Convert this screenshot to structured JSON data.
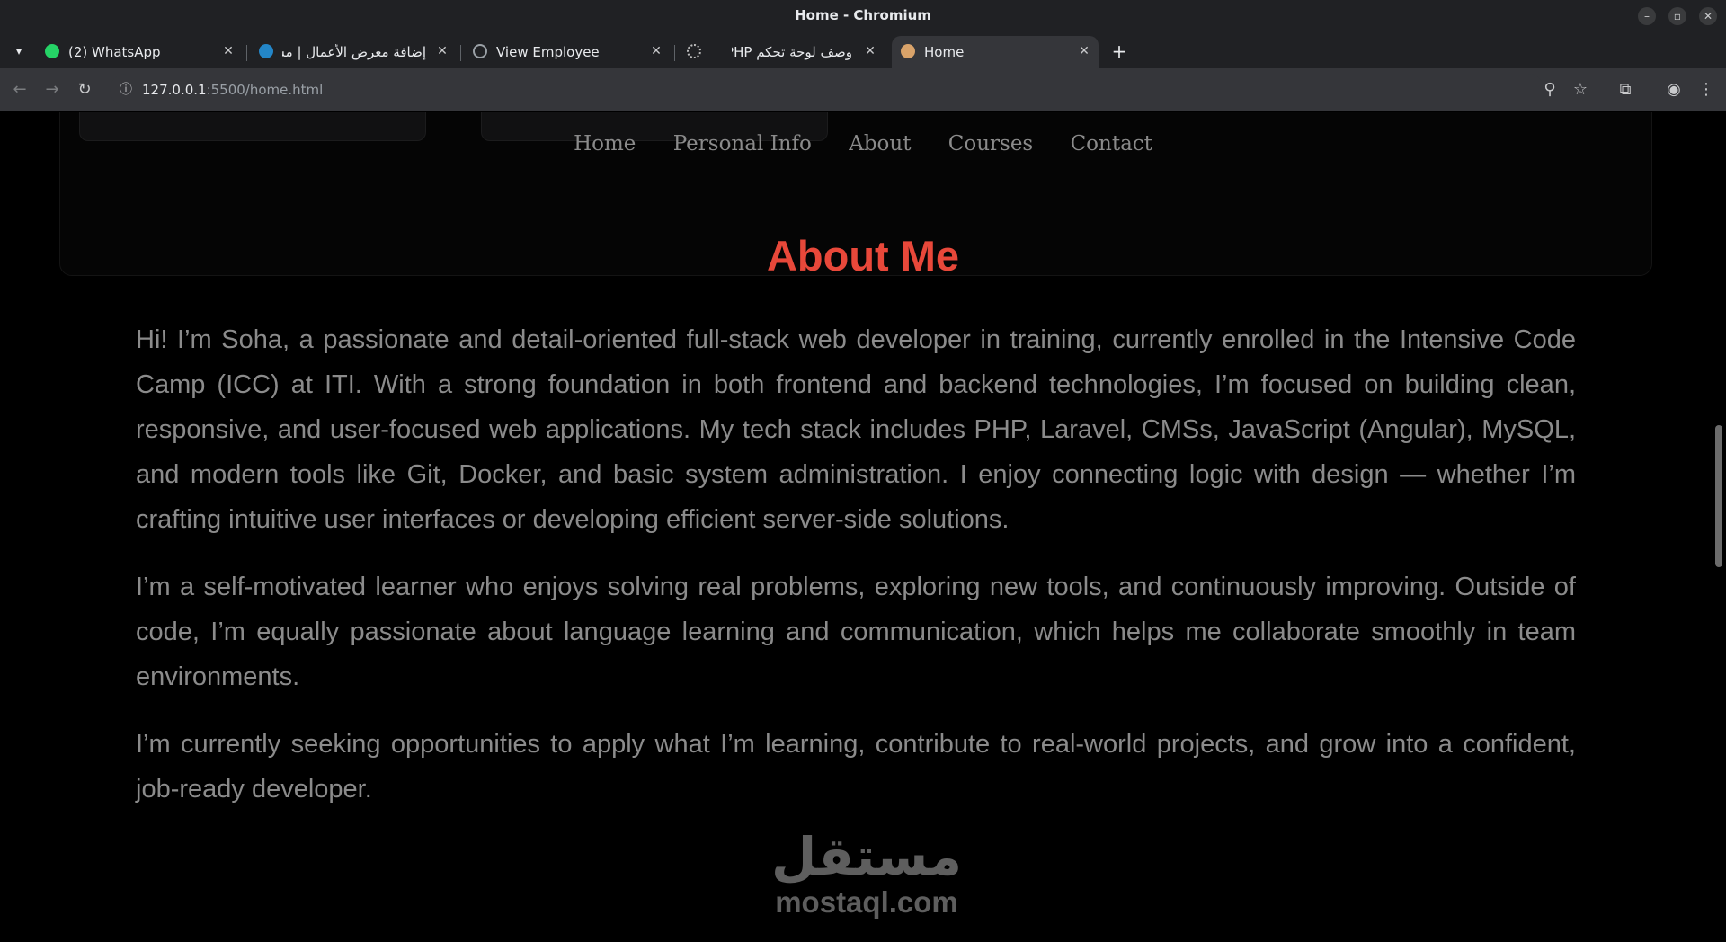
{
  "window": {
    "title": "Home - Chromium",
    "controls": [
      "–",
      "▫",
      "✕"
    ]
  },
  "tabs": [
    {
      "label": "(2) WhatsApp",
      "icon": "whatsapp-icon",
      "color": "#25d366",
      "active": false
    },
    {
      "label": "إضافة معرض الأعمال | مس...",
      "icon": "mostaql-icon",
      "color": "#2386c8",
      "active": false
    },
    {
      "label": "View Employee",
      "icon": "globe-icon",
      "color": "#9aa0a6",
      "active": false
    },
    {
      "label": "وصف لوحة تحكم PHP",
      "icon": "chatgpt-icon",
      "color": "#bdbdbd",
      "active": false
    },
    {
      "label": "Home",
      "icon": "vscode-live-icon",
      "color": "#d9a36a",
      "active": true
    }
  ],
  "toolbar": {
    "back": "←",
    "forward": "→",
    "reload": "↻",
    "url_host": "127.0.0.1",
    "url_rest": ":5500/home.html",
    "zoom": "⚲",
    "bookmark": "☆",
    "extensions": "⧉",
    "profile": "◉",
    "menu": "⋮"
  },
  "nav": {
    "items": [
      "Home",
      "Personal Info",
      "About",
      "Courses",
      "Contact"
    ]
  },
  "about": {
    "title": "About Me",
    "paragraphs": [
      "Hi! I’m Soha, a passionate and detail-oriented full-stack web developer in training, currently enrolled in the Intensive Code Camp (ICC) at ITI. With a strong foundation in both frontend and backend technologies, I’m focused on building clean, responsive, and user-focused web applications. My tech stack includes PHP, Laravel, CMSs, JavaScript (Angular), MySQL, and modern tools like Git, Docker, and basic system administration. I enjoy connecting logic with design — whether I’m crafting intuitive user interfaces or developing efficient server-side solutions.",
      "I’m a self-motivated learner who enjoys solving real problems, exploring new tools, and continuously improving. Outside of code, I’m equally passionate about language learning and communication, which helps me collaborate smoothly in team environments.",
      "I’m currently seeking opportunities to apply what I’m learning, contribute to real-world projects, and grow into a confident, job-ready developer."
    ]
  },
  "watermark": {
    "arabic": "مستقل",
    "latin": "mostaql.com"
  },
  "colors": {
    "accent": "#e8483a",
    "text": "#8b8b8b",
    "background": "#000000"
  }
}
